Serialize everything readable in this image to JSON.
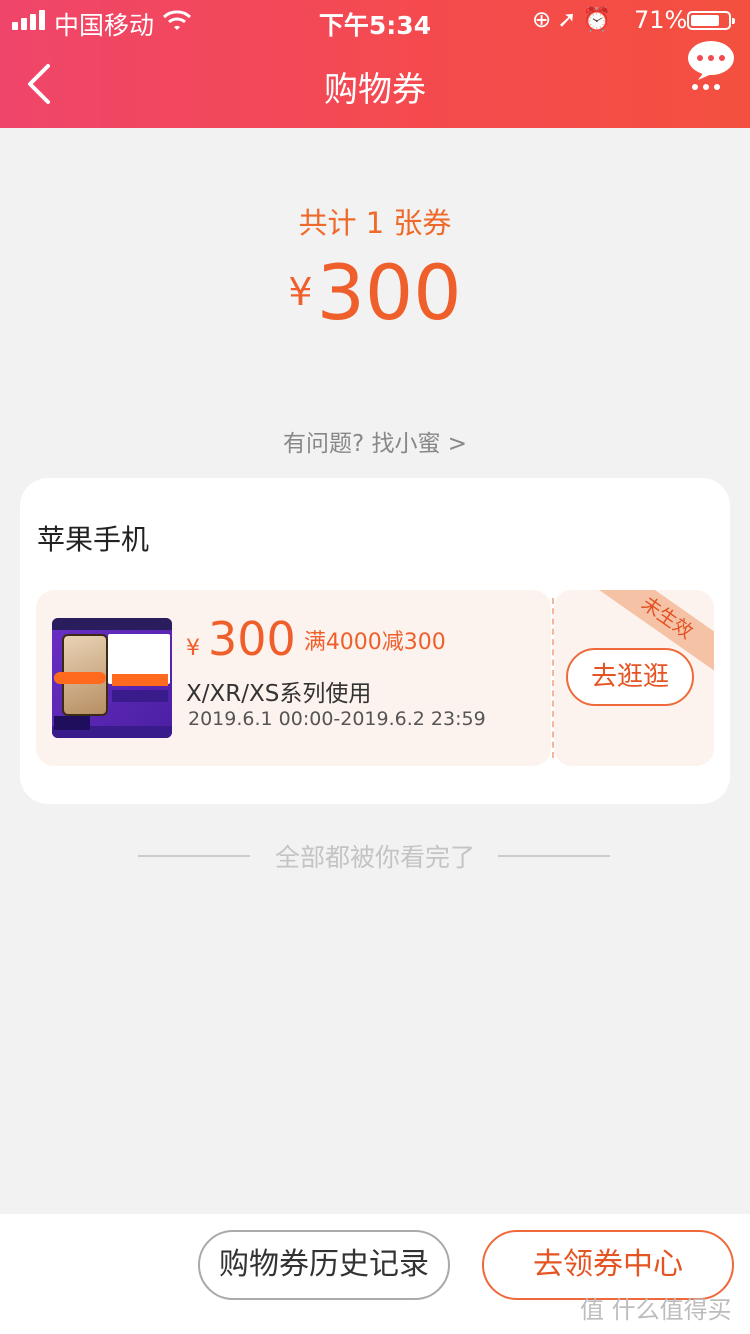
{
  "status_bar": {
    "carrier": "中国移动",
    "time": "下午5:34",
    "battery": "71%"
  },
  "header": {
    "title": "购物券"
  },
  "summary": {
    "count": "共计 1 张券",
    "currency": "¥",
    "total": "300"
  },
  "help_link": "有问题? 找小蜜 >",
  "coupon_group": {
    "category": "苹果手机",
    "coupon": {
      "currency": "¥",
      "amount": "300",
      "condition": "满4000减300",
      "scope": "X/XR/XS系列使用",
      "validity": "2019.6.1 00:00-2019.6.2 23:59",
      "status": "未生效",
      "action": "去逛逛"
    }
  },
  "end_text": "全部都被你看完了",
  "footer": {
    "history_label": "购物券历史记录",
    "center_label": "去领券中心"
  },
  "watermark": "值 什么值得买",
  "colors": {
    "accent": "#ef5f2c",
    "header_start": "#f0456a",
    "header_end": "#f4503f"
  }
}
